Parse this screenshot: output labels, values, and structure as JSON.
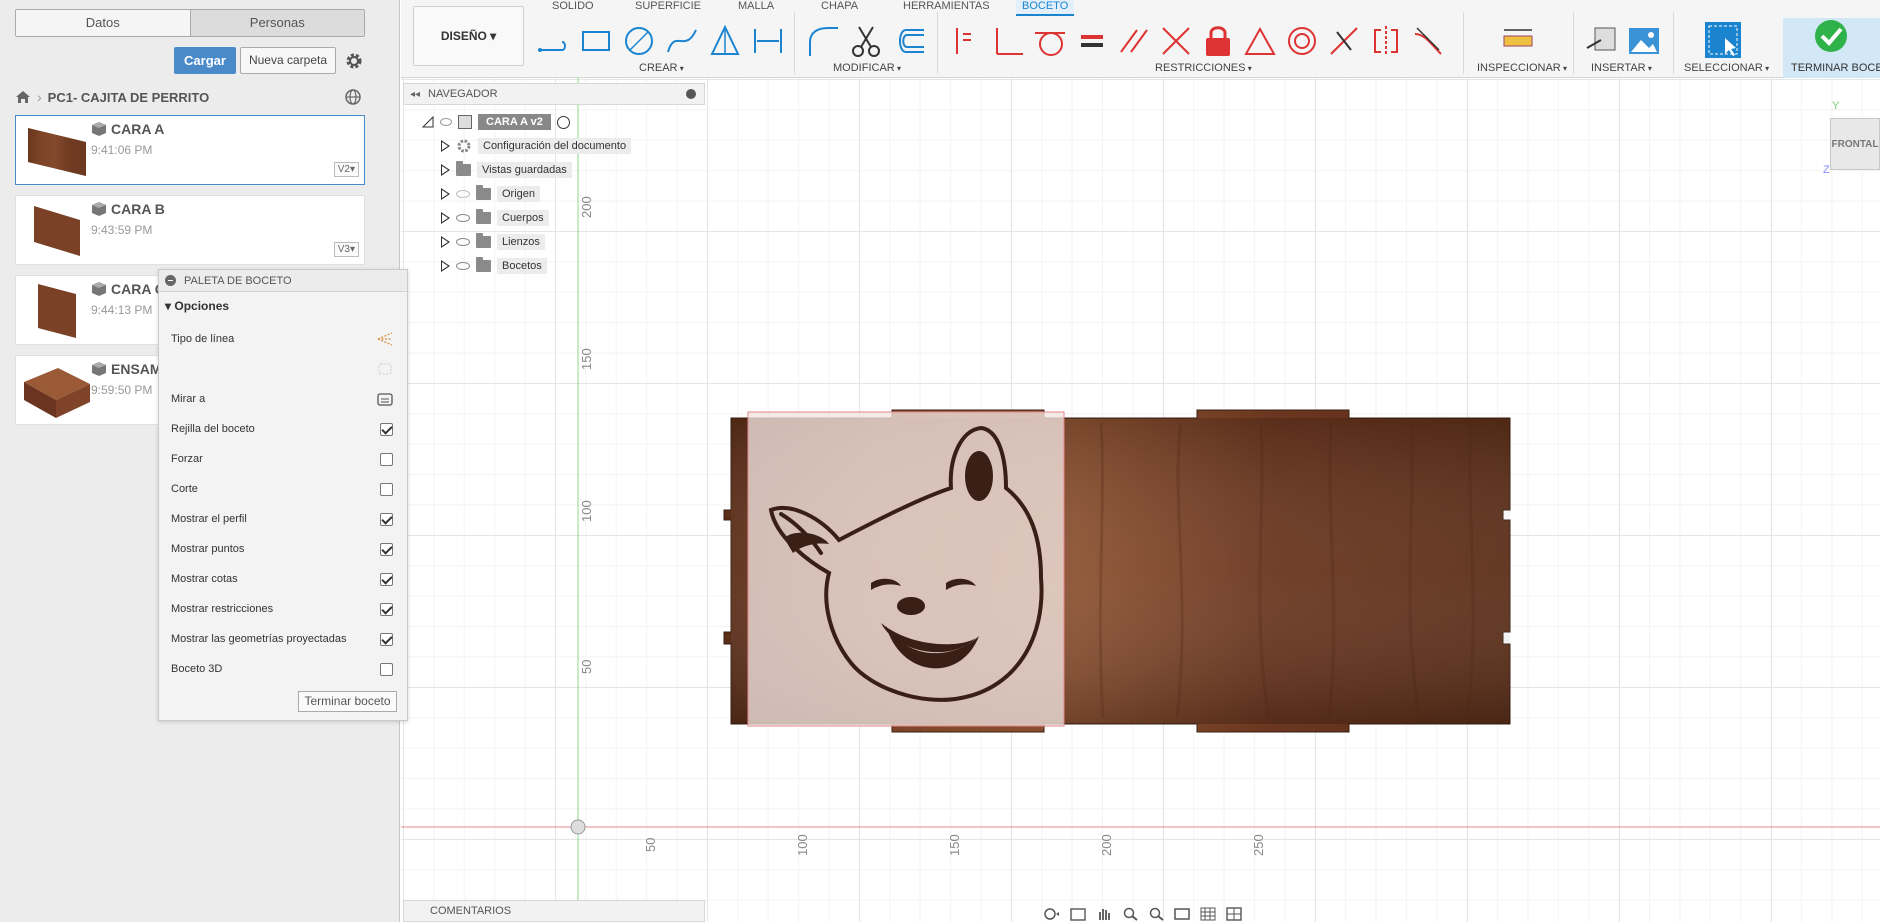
{
  "data_panel": {
    "tabs": [
      "Datos",
      "Personas"
    ],
    "upload_label": "Cargar",
    "new_folder_label": "Nueva carpeta",
    "breadcrumb": "PC1- CAJITA DE PERRITO",
    "files": [
      {
        "name": "CARA A",
        "time": "9:41:06 PM",
        "version": "V2"
      },
      {
        "name": "CARA B",
        "time": "9:43:59 PM",
        "version": "V3"
      },
      {
        "name": "CARA C",
        "time": "9:44:13 PM",
        "version": ""
      },
      {
        "name": "ENSAM",
        "time": "9:59:50 PM",
        "version": ""
      }
    ]
  },
  "palette": {
    "title": "PALETA DE BOCETO",
    "section": "Opciones",
    "options": [
      {
        "label": "Tipo de línea",
        "control": "icon"
      },
      {
        "label": "",
        "control": "icon-disabled"
      },
      {
        "label": "Mirar a",
        "control": "icon"
      },
      {
        "label": "Rejilla del boceto",
        "control": "checkbox",
        "checked": true
      },
      {
        "label": "Forzar",
        "control": "checkbox",
        "checked": false
      },
      {
        "label": "Corte",
        "control": "checkbox",
        "checked": false
      },
      {
        "label": "Mostrar el perfil",
        "control": "checkbox",
        "checked": true
      },
      {
        "label": "Mostrar puntos",
        "control": "checkbox",
        "checked": true
      },
      {
        "label": "Mostrar cotas",
        "control": "checkbox",
        "checked": true
      },
      {
        "label": "Mostrar restricciones",
        "control": "checkbox",
        "checked": true
      },
      {
        "label": "Mostrar las geometrías proyectadas",
        "control": "checkbox",
        "checked": true
      },
      {
        "label": "Boceto 3D",
        "control": "checkbox",
        "checked": false
      }
    ],
    "finish_label": "Terminar boceto"
  },
  "toolbar": {
    "workspace": "DISEÑO",
    "tabs": [
      "SOLIDO",
      "SUPERFICIE",
      "MALLA",
      "CHAPA",
      "HERRAMIENTAS",
      "BOCETO"
    ],
    "active_tab": "BOCETO",
    "groups": [
      "CREAR",
      "MODIFICAR",
      "RESTRICCIONES",
      "INSPECCIONAR",
      "INSERTAR",
      "SELECCIONAR"
    ],
    "finish_label": "TERMINAR BOCETO"
  },
  "navigator": {
    "title": "NAVEGADOR",
    "root": "CARA A v2",
    "items": [
      "Configuración del documento",
      "Vistas guardadas",
      "Origen",
      "Cuerpos",
      "Lienzos",
      "Bocetos"
    ]
  },
  "comments_label": "COMENTARIOS",
  "axes": {
    "x_ticks": [
      "50",
      "100",
      "150",
      "200",
      "250"
    ],
    "y_ticks": [
      "200",
      "150",
      "100",
      "50"
    ]
  },
  "viewcube": {
    "face": "FRONTAL",
    "y": "Y",
    "z": "Z"
  },
  "colors": {
    "accent": "#1a84d0",
    "upload": "#4a8ac9",
    "wood": "#6b3a22",
    "finish_green": "#2fb24a"
  }
}
